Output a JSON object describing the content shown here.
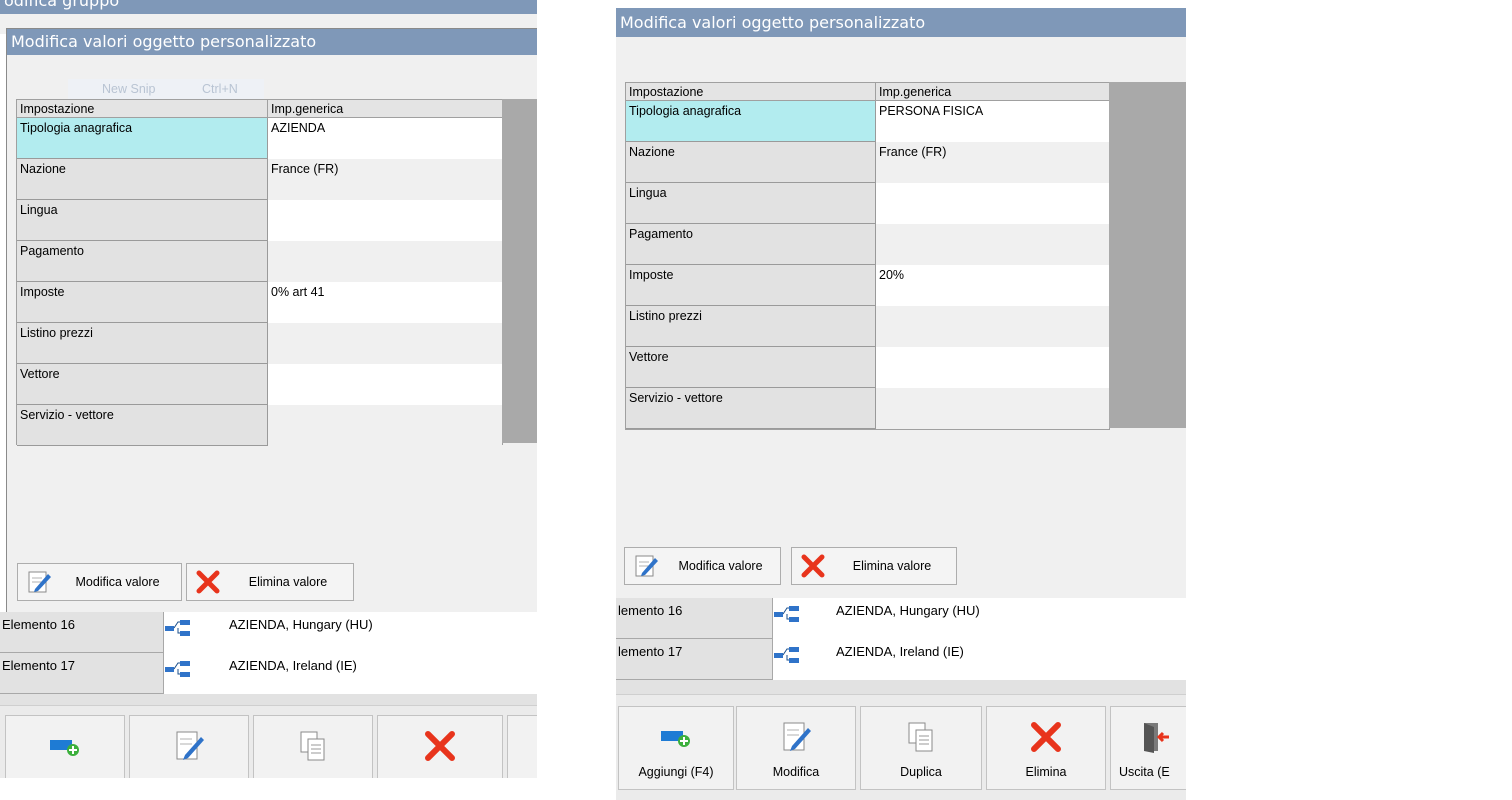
{
  "left": {
    "back_title": "odifica gruppo",
    "menu_hint": "New Snip",
    "menu_shortcut": "Ctrl+N",
    "dialog_title": "Modifica valori oggetto personalizzato",
    "grid": {
      "col_name": "Impostazione",
      "col_value": "Imp.generica",
      "rows": [
        {
          "name": "Tipologia anagrafica",
          "value": "AZIENDA"
        },
        {
          "name": "Nazione",
          "value": "France (FR)"
        },
        {
          "name": "Lingua",
          "value": ""
        },
        {
          "name": "Pagamento",
          "value": ""
        },
        {
          "name": "Imposte",
          "value": "0% art 41"
        },
        {
          "name": "Listino prezzi",
          "value": ""
        },
        {
          "name": "Vettore",
          "value": ""
        },
        {
          "name": "Servizio - vettore",
          "value": ""
        }
      ]
    },
    "buttons": {
      "edit": "Modifica valore",
      "delete": "Elimina valore"
    },
    "list": [
      {
        "name": "Elemento 16",
        "value": "AZIENDA, Hungary (HU)"
      },
      {
        "name": "Elemento 17",
        "value": "AZIENDA, Ireland (IE)"
      }
    ]
  },
  "right": {
    "dialog_title": "Modifica valori oggetto personalizzato",
    "grid": {
      "col_name": "Impostazione",
      "col_value": "Imp.generica",
      "rows": [
        {
          "name": "Tipologia anagrafica",
          "value": "PERSONA FISICA"
        },
        {
          "name": "Nazione",
          "value": "France (FR)"
        },
        {
          "name": "Lingua",
          "value": ""
        },
        {
          "name": "Pagamento",
          "value": ""
        },
        {
          "name": "Imposte",
          "value": "20%"
        },
        {
          "name": "Listino prezzi",
          "value": ""
        },
        {
          "name": "Vettore",
          "value": ""
        },
        {
          "name": "Servizio - vettore",
          "value": ""
        }
      ]
    },
    "buttons": {
      "edit": "Modifica valore",
      "delete": "Elimina valore"
    },
    "list": [
      {
        "name": "lemento 16",
        "value": "AZIENDA, Hungary (HU)"
      },
      {
        "name": "lemento 17",
        "value": "AZIENDA, Ireland (IE)"
      }
    ],
    "toolbar": {
      "add": "Aggiungi (F4)",
      "edit": "Modifica",
      "duplicate": "Duplica",
      "delete": "Elimina",
      "exit": "Uscita (E"
    }
  },
  "colors": {
    "title": "#7f98b8",
    "selected": "#b2ecef",
    "delete": "#e8341c",
    "add": "#1e7bd4"
  }
}
